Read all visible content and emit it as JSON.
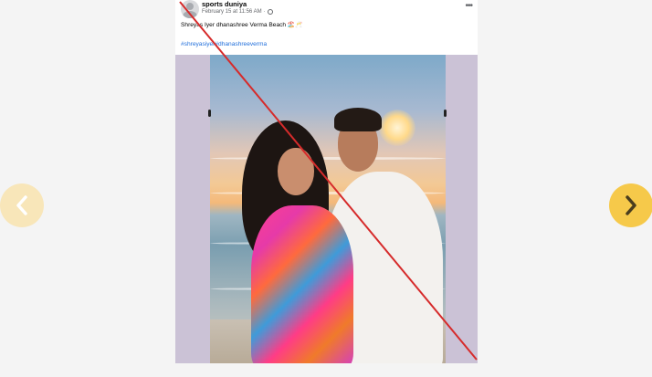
{
  "post": {
    "author": "sports duniya",
    "timestamp": "February 15 at 11:56 AM",
    "separator": "·",
    "caption": "Shreyas Iyer dhanashree Verma Beach 🏖️🥂",
    "hashtags": [
      "#shreyasiyer",
      "#dhanashreeverma"
    ],
    "more_label": "•••"
  },
  "icons": {
    "avatar": "profile-avatar-icon",
    "privacy": "globe-icon",
    "more": "more-options-icon",
    "prev": "chevron-left-icon",
    "next": "chevron-right-icon"
  },
  "colors": {
    "link": "#216fdb",
    "strike_line": "#d62b2b",
    "nav_prev": "#f8e6b9",
    "nav_next": "#f6c94a",
    "page_bg": "#f4f4f4"
  }
}
